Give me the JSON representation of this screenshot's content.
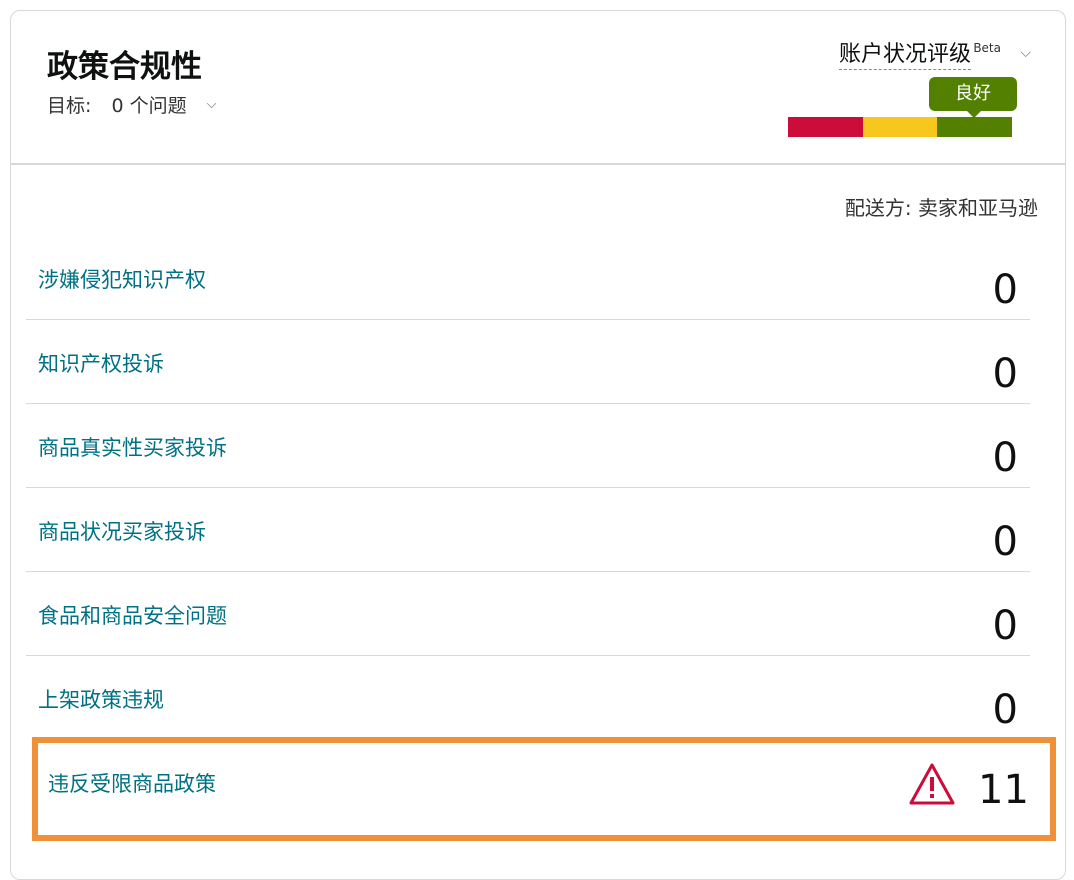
{
  "header": {
    "title": "政策合规性",
    "target_label": "目标:",
    "target_value": "0 个问题",
    "health_label": "账户状况评级",
    "beta": "Beta",
    "rating_status": "良好",
    "rating_colors": [
      "#cc0c39",
      "#f7c71d",
      "#538000"
    ]
  },
  "fulfilled_by": "配送方: 卖家和亚马逊",
  "rows": [
    {
      "label": "涉嫌侵犯知识产权",
      "count": "0"
    },
    {
      "label": "知识产权投诉",
      "count": "0"
    },
    {
      "label": "商品真实性买家投诉",
      "count": "0"
    },
    {
      "label": "商品状况买家投诉",
      "count": "0"
    },
    {
      "label": "食品和商品安全问题",
      "count": "0"
    },
    {
      "label": "上架政策违规",
      "count": "0"
    }
  ],
  "restricted": {
    "label": "违反受限商品政策",
    "count": "11",
    "icon": "warning-icon",
    "highlight_color": "#f0913a"
  }
}
